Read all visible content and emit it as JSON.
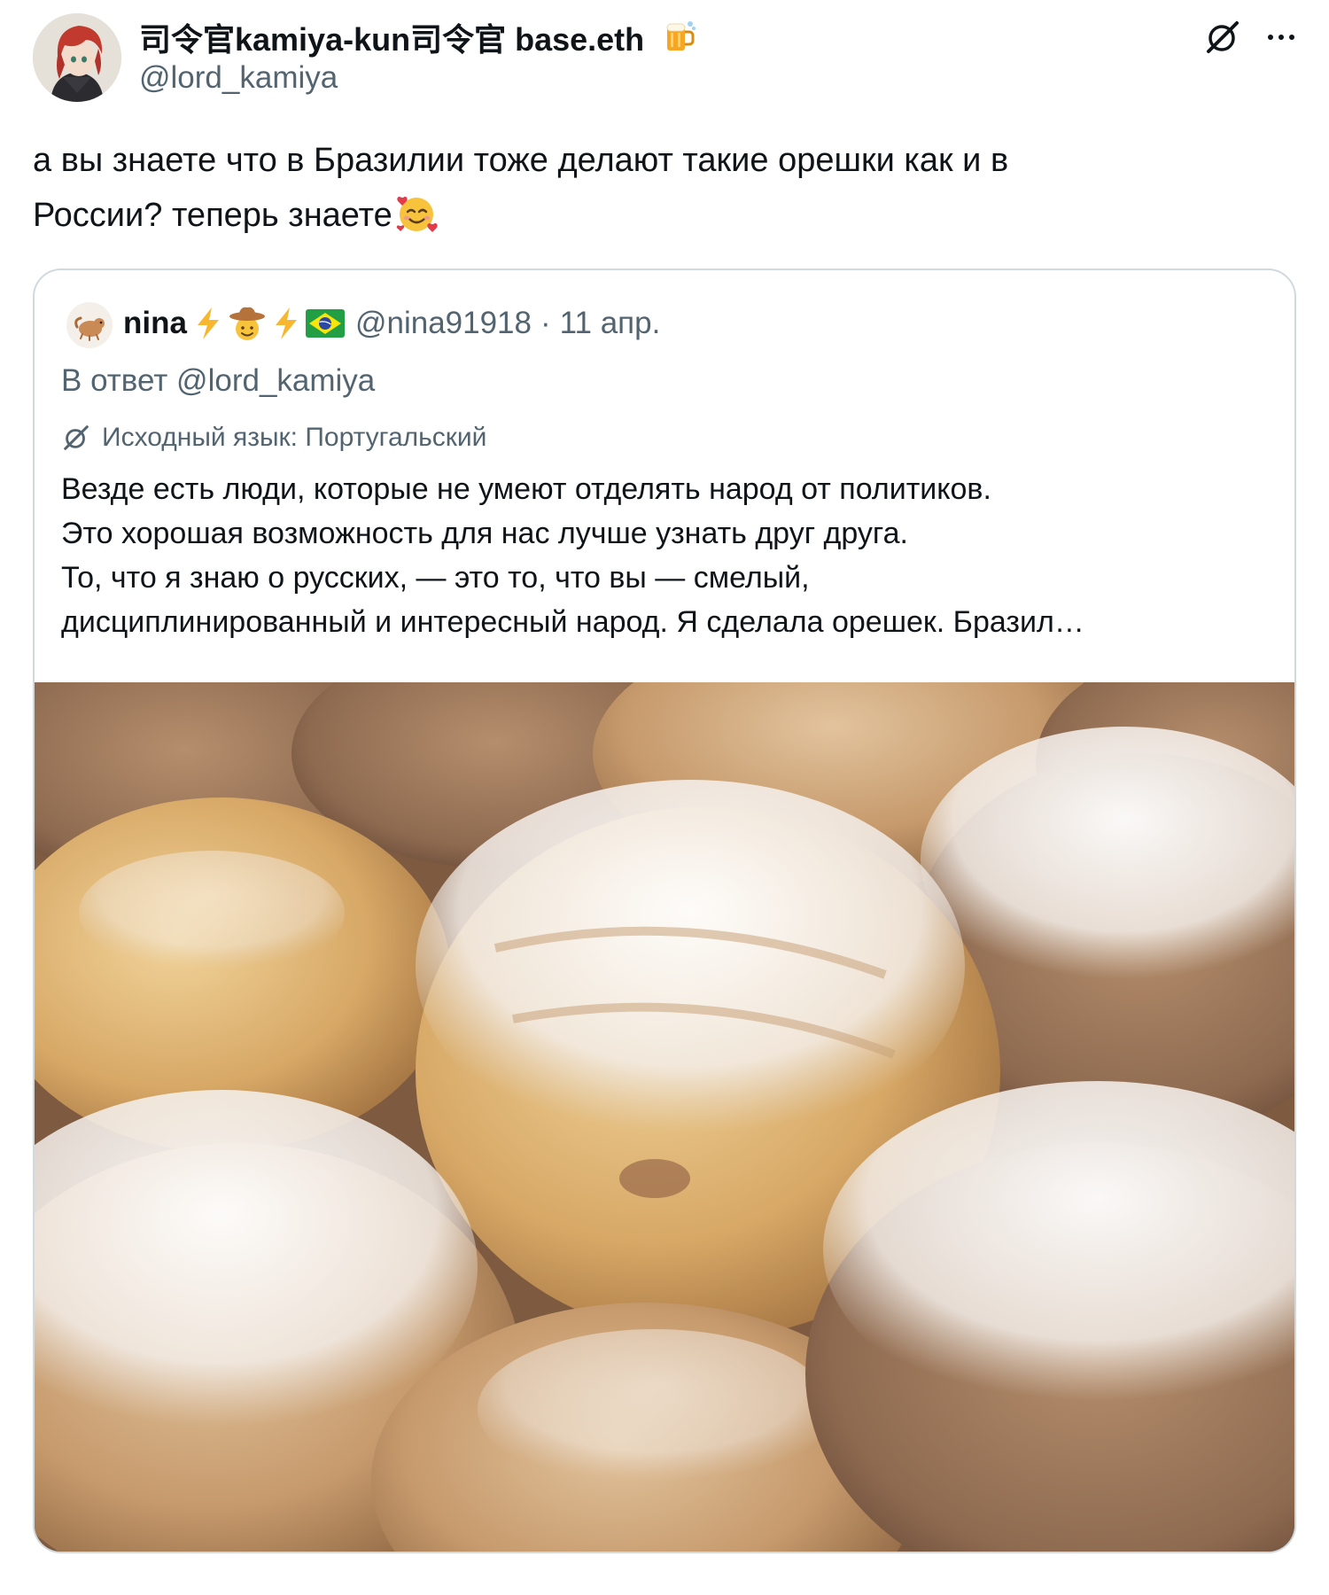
{
  "tweet": {
    "author": {
      "display_name": "司令官kamiya-kun司令官 base.eth",
      "handle": "@lord_kamiya",
      "badge_icon": "beer-mug-icon"
    },
    "text_line1": "а вы знаете что в Бразилии тоже делают такие орешки как и в",
    "text_line2": "России? теперь знаете",
    "text_emoji": "smiling-face-with-hearts-emoji",
    "actions": {
      "grok_icon": "grok-icon",
      "more_icon": "more-icon"
    }
  },
  "quote": {
    "author_name": "nina",
    "author_emojis": [
      "lightning-emoji",
      "cowboy-face-emoji",
      "lightning-emoji",
      "brazil-flag-emoji"
    ],
    "handle": "@nina91918",
    "separator": "·",
    "date": "11 апр.",
    "reply_to": "В ответ @lord_kamiya",
    "language_note": "Исходный язык: Португальский",
    "body_lines": [
      "Везде есть люди, которые не умеют отделять народ от политиков.",
      "Это хорошая возможность для нас лучше узнать друг друга.",
      "То, что я знаю о русских, — это то, что вы — смелый,",
      "дисциплинированный и интересный народ. Я сделала орешек. Бразил…"
    ],
    "image_alt": "photo of walnut-shaped cookies dusted with powdered sugar"
  },
  "colors": {
    "text_primary": "#0f1419",
    "text_secondary": "#536471",
    "border": "#cfd9de"
  }
}
